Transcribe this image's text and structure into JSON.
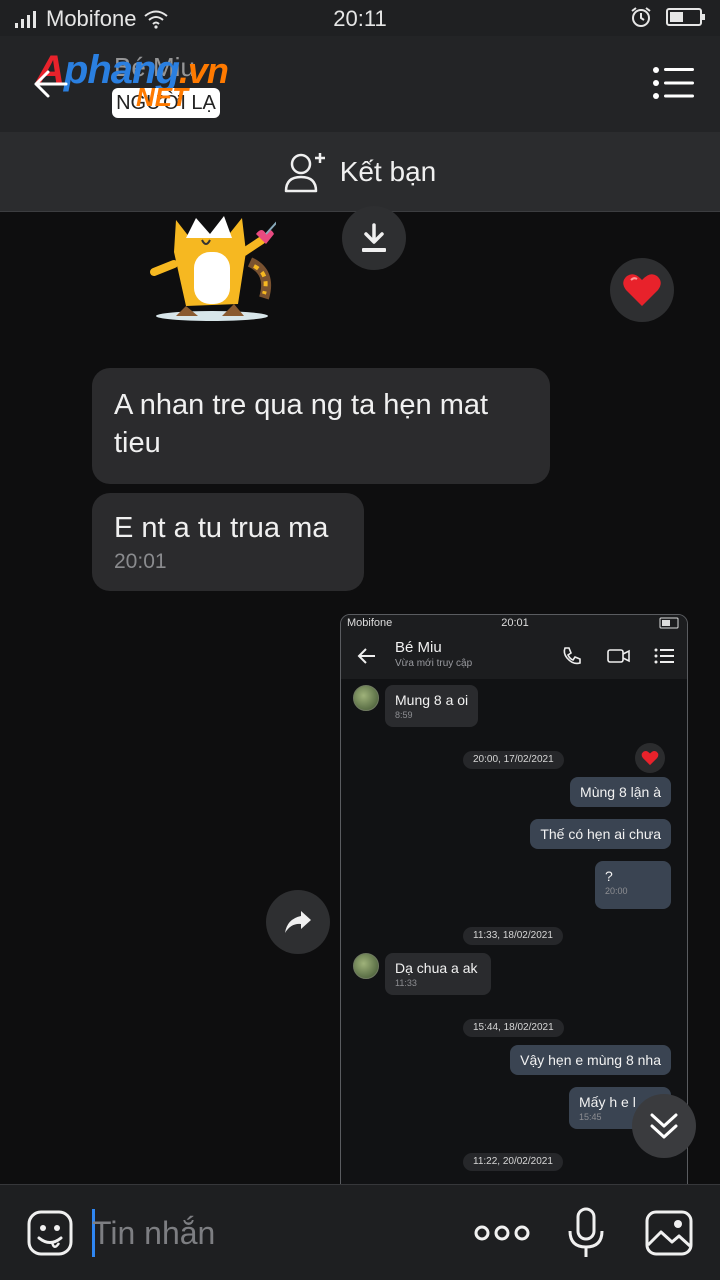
{
  "status_bar": {
    "carrier": "Mobifone",
    "time": "20:11"
  },
  "header": {
    "title": "Bé Miu",
    "tag": "NGƯỜI LẠ",
    "logo": {
      "a": "A",
      "phang": "phang",
      "vn": ".vn",
      "net": "NET"
    }
  },
  "add_friend": {
    "label": "Kết bạn"
  },
  "messages": [
    {
      "text": "A nhan tre qua ng ta hẹn mat tieu"
    },
    {
      "text": "E nt a tu trua ma",
      "time": "20:01"
    }
  ],
  "embedded_screenshot": {
    "status_carrier": "Mobifone",
    "status_time": "20:01",
    "contact_name": "Bé Miu",
    "contact_status": "Vừa mới truy cập",
    "messages": [
      {
        "dir": "in",
        "text": "Mung 8 a oi",
        "time": "8:59"
      },
      {
        "chip": "20:00, 17/02/2021"
      },
      {
        "dir": "out",
        "text": "Mùng 8 lận à"
      },
      {
        "dir": "out",
        "text": "Thế có hẹn ai chưa"
      },
      {
        "dir": "out",
        "text": "?",
        "time": "20:00"
      },
      {
        "chip": "11:33, 18/02/2021"
      },
      {
        "dir": "in",
        "text": "Dạ chua a ak",
        "time": "11:33"
      },
      {
        "chip": "15:44, 18/02/2021"
      },
      {
        "dir": "out",
        "text": "Vậy hẹn e mùng 8 nha"
      },
      {
        "dir": "out",
        "text": "Mấy h e l",
        "time": "15:45"
      },
      {
        "chip": "11:22, 20/02/2021"
      }
    ]
  },
  "composer": {
    "placeholder": "Tin nhắn"
  },
  "colors": {
    "accent": "#2f86f2",
    "heart": "#e8222b",
    "background": "#0e0e0f"
  }
}
